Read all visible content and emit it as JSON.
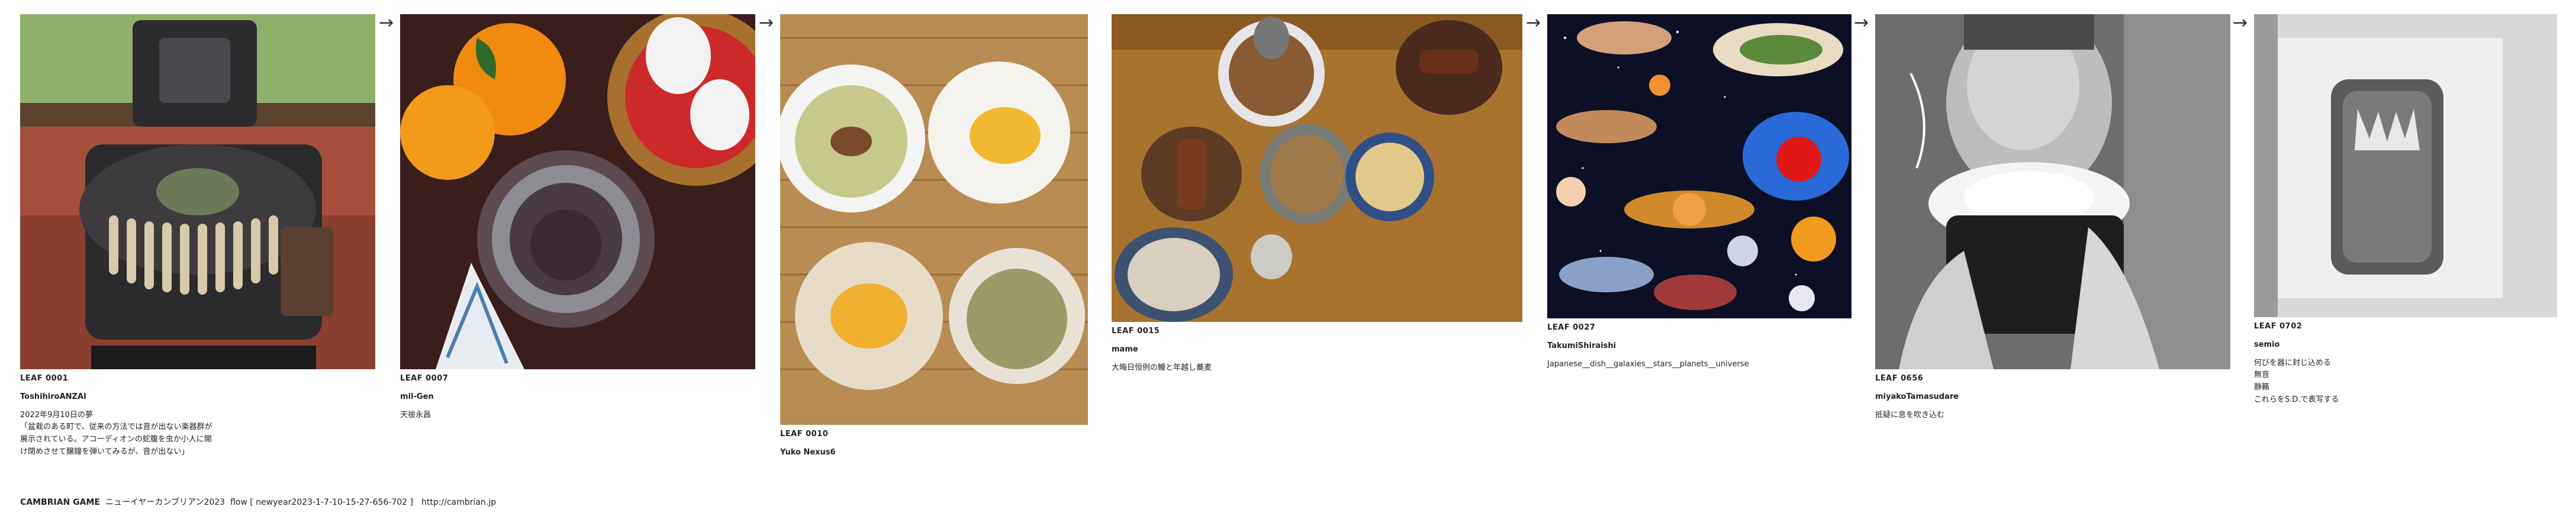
{
  "leaves": [
    {
      "code": "LEAF 0001",
      "author": "ToshihiroANZAI",
      "comment": "2022年9月10日の夢\n「盆栽のある町で、従来の方法では音が出ない楽器群が\n展示されている。アコーディオンの蛇腹を虫か小人に開\nけ閉めさせて醸鐘を弾いてみるが、音が出ない」"
    },
    {
      "code": "LEAF 0007",
      "author": "mil-Gen",
      "comment": "天祓永昌"
    },
    {
      "code": "LEAF 0010",
      "author": "Yuko Nexus6",
      "comment": ""
    },
    {
      "code": "LEAF 0015",
      "author": "mame",
      "comment": "大晦日恒例の鰻と年越し蕎麦"
    },
    {
      "code": "LEAF 0027",
      "author": "TakumiShiraishi",
      "comment": "Japanese__dish__galaxies__stars__planets__universe"
    },
    {
      "code": "LEAF 0656",
      "author": "miyakoTamasudare",
      "comment": "抵疑に息を吹き込む"
    },
    {
      "code": "LEAF 0702",
      "author": "semio",
      "comment": "何びを器に封じ込める\n無音\n静籟\nこれらをS.D.で表写する"
    }
  ],
  "arrow_glyph": "→",
  "footer": {
    "game": "CAMBRIAN GAME",
    "title": "ニューイヤーカンブリアン2023  flow [ newyear2023-1-7-10-15-27-656-702 ]",
    "url": "http://cambrian.jp"
  },
  "colors": {
    "page_bg": "#ffffff",
    "text": "#222222",
    "arrow": "#333333"
  }
}
